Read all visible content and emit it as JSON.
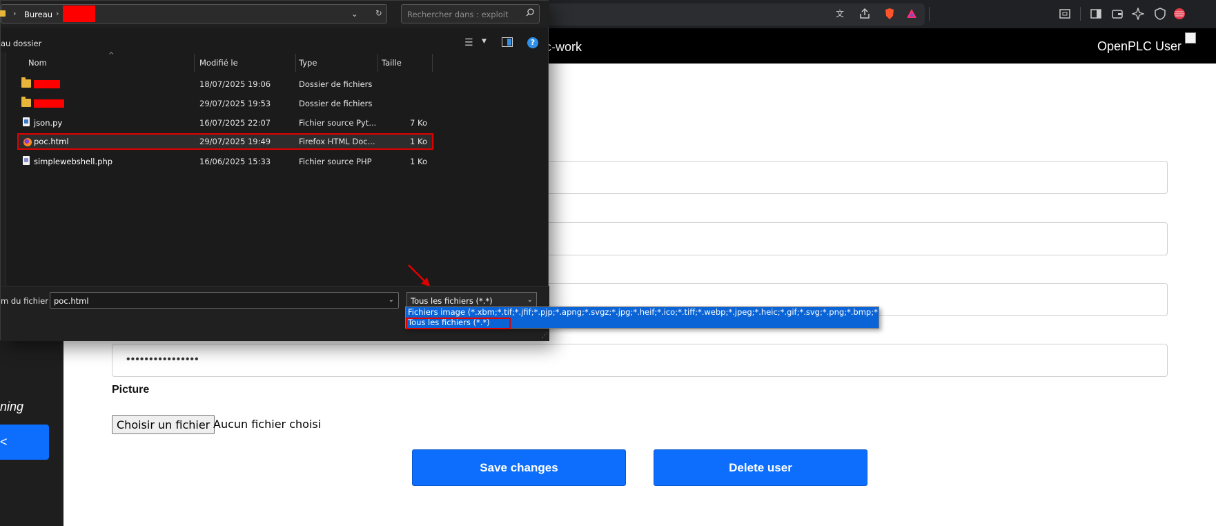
{
  "dialog": {
    "address": {
      "crumbs": [
        "Bureau"
      ]
    },
    "search": {
      "placeholder": "Rechercher dans : exploit"
    },
    "commands": {
      "new_folder": "au dossier"
    },
    "columns": {
      "name": "Nom",
      "modified": "Modifié le",
      "type": "Type",
      "size": "Taille"
    },
    "files": [
      {
        "name": "",
        "modified": "18/07/2025 19:06",
        "type": "Dossier de fichiers",
        "size": "",
        "icon": "folder-icon",
        "redacted": true
      },
      {
        "name": "",
        "modified": "29/07/2025 19:53",
        "type": "Dossier de fichiers",
        "size": "",
        "icon": "folder-icon",
        "redacted": true
      },
      {
        "name": "json.py",
        "modified": "16/07/2025 22:07",
        "type": "Fichier source Pyt...",
        "size": "7 Ko",
        "icon": "python-file-icon"
      },
      {
        "name": "poc.html",
        "modified": "29/07/2025 19:49",
        "type": "Firefox HTML Doc...",
        "size": "1 Ko",
        "icon": "firefox-html-icon",
        "selected": true
      },
      {
        "name": "simplewebshell.php",
        "modified": "16/06/2025 15:33",
        "type": "Fichier source PHP",
        "size": "1 Ko",
        "icon": "php-file-icon"
      }
    ],
    "filename_label": "m du fichier :",
    "filename_value": "poc.html",
    "filter_value": "Tous les fichiers (*.*)",
    "filter_options": [
      "Fichiers image (*.xbm;*.tif;*.jfif;*.pjp;*.apng;*.svgz;*.jpg;*.heif;*.ico;*.tiff;*.webp;*.jpeg;*.heic;*.gif;*.svg;*.png;*.bmp;*.pjpeg;*.avif)",
      "Tous les fichiers (*.*)"
    ]
  },
  "appbar": {
    "title": "lc-work",
    "user": "OpenPLC User"
  },
  "sidebar": {
    "text": "ning",
    "button": "<"
  },
  "form": {
    "password_mask": "••••••••••••••••",
    "picture_label": "Picture",
    "choose_file": "Choisir un fichier",
    "no_file": "Aucun fichier choisi",
    "save_button": "Save changes",
    "delete_button": "Delete user"
  },
  "colors": {
    "accent": "#0d6efd",
    "highlight": "#e00000",
    "dropdown_selected": "#0a64d6"
  }
}
